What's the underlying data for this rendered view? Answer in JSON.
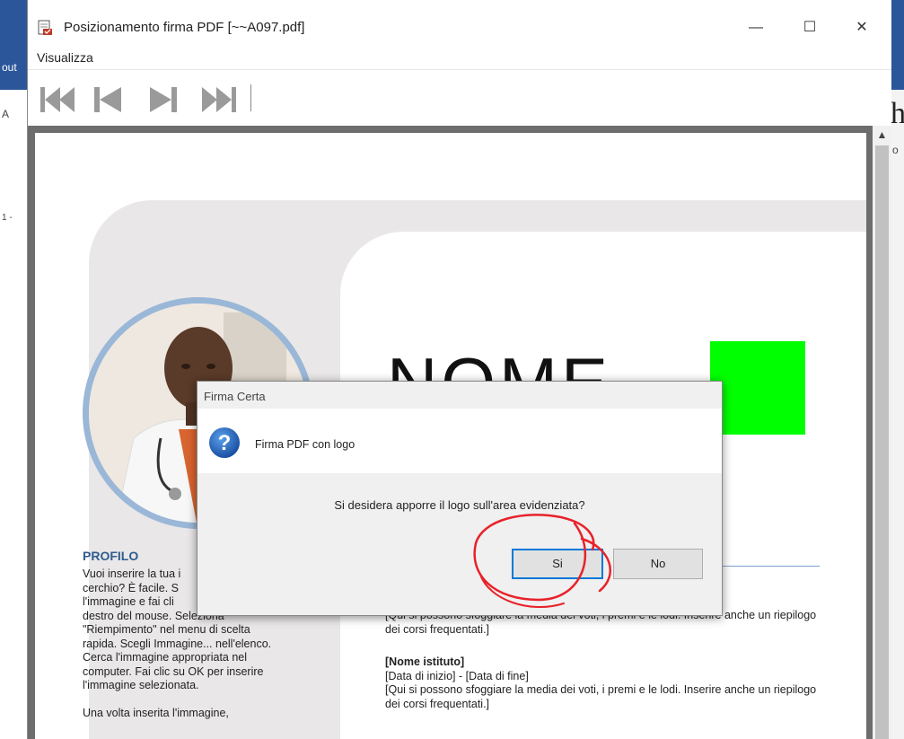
{
  "window": {
    "title": "Posizionamento firma PDF [~~A097.pdf]",
    "menu": [
      "Visualizza"
    ],
    "controls": {
      "minimize": "—",
      "maximize": "☐",
      "close": "✕"
    }
  },
  "toolbar": {
    "buttons": [
      "first-page",
      "previous-page",
      "next-page",
      "last-page"
    ]
  },
  "document": {
    "name_heading": "NOME",
    "profile_title": "PROFILO",
    "profile_text": "Vuoi inserire la tua i\ncerchio? È facile. S\nl'immagine e fai cli\ndestro del mouse. Seleziona\n\"Riempimento\" nel menu di scelta\nrapida. Scegli Immagine... nell'elenco.\nCerca l'immagine appropriata nel\ncomputer. Fai clic su OK per inserire\nl'immagine selezionata.\n\nUna volta inserita l'immagine,",
    "edu1_text": "[Qui si possono sfoggiare la media dei voti, i premi e le lodi. Inserire anche un riepilogo dei corsi frequentati.]",
    "edu2_name": "[Nome istituto]",
    "edu2_dates": "[Data di inizio] - [Data di fine]",
    "edu2_text": "[Qui si possono sfoggiare la media dei voti, i premi e le lodi. Inserire anche un riepilogo dei corsi frequentati.]"
  },
  "dialog": {
    "title": "Firma Certa",
    "heading": "Firma PDF con logo",
    "message": "Si desidera apporre il logo sull'area evidenziata?",
    "yes_label": "Si",
    "no_label": "No",
    "icon": "question-icon"
  },
  "background_app": {
    "left_fragments": [
      "out",
      "A",
      "1 -"
    ],
    "right_big": "h",
    "right_small": "o"
  },
  "colors": {
    "highlight_area": "#00ff00",
    "profile_accent": "#2f5d8e",
    "annotation": "#e8222a",
    "default_button_border": "#0078d7"
  }
}
